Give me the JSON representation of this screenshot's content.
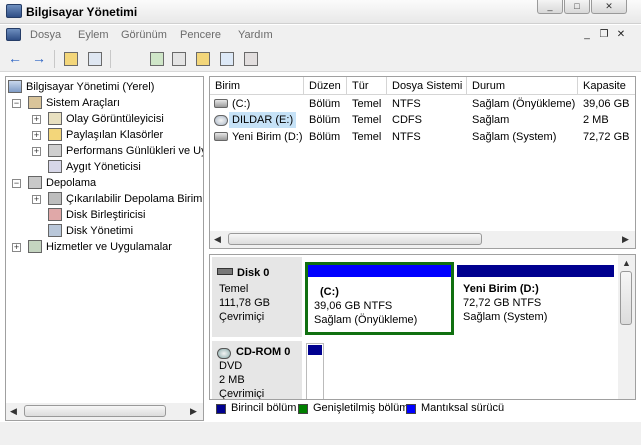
{
  "window": {
    "title": "Bilgisayar Yönetimi"
  },
  "menu": [
    "Dosya",
    "Eylem",
    "Görünüm",
    "Pencere",
    "Yardım"
  ],
  "tree": {
    "root": "Bilgisayar Yönetimi (Yerel)",
    "items": [
      {
        "label": "Sistem Araçları",
        "level": 1,
        "expander": "-"
      },
      {
        "label": "Olay Görüntüleyicisi",
        "level": 2,
        "expander": "+"
      },
      {
        "label": "Paylaşılan Klasörler",
        "level": 2,
        "expander": "+"
      },
      {
        "label": "Performans Günlükleri ve Uy",
        "level": 2,
        "expander": "+"
      },
      {
        "label": "Aygıt Yöneticisi",
        "level": 2,
        "expander": ""
      },
      {
        "label": "Depolama",
        "level": 1,
        "expander": "-"
      },
      {
        "label": "Çıkarılabilir Depolama Birimi",
        "level": 2,
        "expander": "+"
      },
      {
        "label": "Disk Birleştiricisi",
        "level": 2,
        "expander": ""
      },
      {
        "label": "Disk Yönetimi",
        "level": 2,
        "expander": ""
      },
      {
        "label": "Hizmetler ve Uygulamalar",
        "level": 1,
        "expander": "+"
      }
    ]
  },
  "volumes": {
    "columns": [
      "Birim",
      "Düzen",
      "Tür",
      "Dosya Sistemi",
      "Durum",
      "Kapasite"
    ],
    "rows": [
      [
        "(C:)",
        "Bölüm",
        "Temel",
        "NTFS",
        "Sağlam (Önyükleme)",
        "39,06 GB"
      ],
      [
        "DILDAR (E:)",
        "Bölüm",
        "Temel",
        "CDFS",
        "Sağlam",
        "2 MB"
      ],
      [
        "Yeni Birim (D:)",
        "Bölüm",
        "Temel",
        "NTFS",
        "Sağlam (System)",
        "72,72 GB"
      ]
    ]
  },
  "disks": [
    {
      "name": "Disk 0",
      "type": "Temel",
      "size": "111,78 GB",
      "status": "Çevrimiçi",
      "partitions": [
        {
          "title": "(C:)",
          "fs": "39,06 GB NTFS",
          "status": "Sağlam (Önyükleme)"
        },
        {
          "title": "Yeni Birim  (D:)",
          "fs": "72,72 GB NTFS",
          "status": "Sağlam (System)"
        }
      ]
    },
    {
      "name": "CD-ROM 0",
      "type": "DVD",
      "size": "2 MB",
      "status": "Çevrimiçi"
    }
  ],
  "legend": [
    {
      "label": "Birincil bölüm",
      "color": "#00008f"
    },
    {
      "label": "Genişletilmiş bölüm",
      "color": "#008000"
    },
    {
      "label": "Mantıksal sürücü",
      "color": "#0000ff"
    }
  ],
  "colors": {
    "selection": "#c6e2f7",
    "primary": "#00008f",
    "selected_border": "#107010"
  },
  "icons": [
    "back-icon",
    "forward-icon",
    "up-folder-icon",
    "show-tree-icon",
    "refresh-icon",
    "export-icon",
    "properties-icon",
    "help-icon",
    "console-icon",
    "open-folder-icon",
    "search-icon",
    "settings-icon"
  ]
}
